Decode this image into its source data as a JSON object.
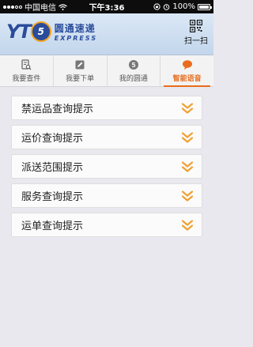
{
  "status_bar": {
    "carrier": "中国电信",
    "time": "下午3:36",
    "battery": "100%"
  },
  "header": {
    "logo_mark": "YT",
    "logo_circle": "5",
    "logo_cn": "圆通速递",
    "logo_en": "EXPRESS",
    "scan_label": "扫一扫"
  },
  "tabs": [
    {
      "label": "我要查件",
      "icon": "search-document-icon",
      "active": false
    },
    {
      "label": "我要下单",
      "icon": "pencil-icon",
      "active": false
    },
    {
      "label": "我的圆通",
      "icon": "yto-logo-icon",
      "active": false
    },
    {
      "label": "智能语音",
      "icon": "speech-bubble-icon",
      "active": true
    }
  ],
  "items": [
    {
      "label": "禁运品查询提示"
    },
    {
      "label": "运价查询提示"
    },
    {
      "label": "派送范围提示"
    },
    {
      "label": "服务查询提示"
    },
    {
      "label": "运单查询提示"
    }
  ],
  "colors": {
    "accent": "#e86c1c",
    "chevron": "#f0a033",
    "brand_blue": "#2a4c9b"
  }
}
